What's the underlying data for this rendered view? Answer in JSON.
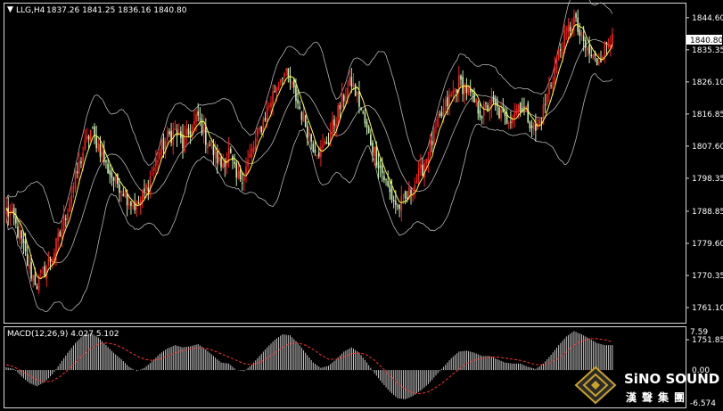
{
  "header": {
    "arrow_glyph": "▼",
    "symbol": "LLG,H4",
    "ohlc": "1837.26 1841.25 1836.16 1840.80"
  },
  "current_price_label": "1840.80",
  "macd": {
    "label": "MACD(12,26,9) 4.027 5.102",
    "axis_top": "7.59",
    "axis_mid": "0.00",
    "axis_bottom": "-6.574"
  },
  "brand": {
    "name_en": "SiNO SOUND",
    "name_zh": "漢聲集團",
    "icon": "diamond-logo-icon"
  },
  "colors": {
    "background": "#000000",
    "bull": "#ff2020",
    "bear": "#c8f0b4",
    "ma": "#ffff40",
    "band": "#b4b4b4",
    "signal": "#ff3030",
    "histogram": "#c8c8c8",
    "frame": "#d8d8d8"
  },
  "chart_data": {
    "type": "candlestick",
    "symbol": "LLG",
    "timeframe": "H4",
    "ylim": [
      1757.0,
      1848.4
    ],
    "y_ticks": [
      1844.6,
      1835.35,
      1826.1,
      1816.85,
      1807.6,
      1798.35,
      1788.85,
      1779.6,
      1770.35,
      1761.1,
      1751.85
    ],
    "y_tick_labels": [
      "1844.60",
      "1835.35",
      "1826.10",
      "1816.85",
      "1807.60",
      "1798.35",
      "1788.85",
      "1779.60",
      "1770.35",
      "1761.10",
      "1751.85"
    ],
    "close_path": [
      1789,
      1786,
      1780,
      1772,
      1768,
      1772,
      1776,
      1782,
      1790,
      1798,
      1806,
      1812,
      1808,
      1802,
      1798,
      1796,
      1792,
      1790,
      1794,
      1800,
      1806,
      1810,
      1812,
      1808,
      1812,
      1816,
      1810,
      1806,
      1802,
      1806,
      1798,
      1800,
      1806,
      1812,
      1818,
      1824,
      1829,
      1826,
      1820,
      1814,
      1808,
      1806,
      1810,
      1816,
      1822,
      1826,
      1820,
      1812,
      1806,
      1800,
      1794,
      1790,
      1792,
      1796,
      1800,
      1806,
      1812,
      1818,
      1822,
      1826,
      1824,
      1820,
      1817,
      1820,
      1818,
      1815,
      1817,
      1820,
      1816,
      1812,
      1818,
      1826,
      1834,
      1840,
      1844,
      1838,
      1834,
      1832,
      1836,
      1840
    ],
    "macd_ylim": [
      -6.574,
      7.59
    ],
    "macd_histogram": [
      0.5,
      0.2,
      -1.2,
      -2.4,
      -3.0,
      -2.2,
      -0.8,
      1.2,
      3.2,
      5.0,
      6.4,
      6.8,
      6.0,
      4.6,
      3.2,
      2.0,
      0.6,
      -0.2,
      0.4,
      1.6,
      3.0,
      4.0,
      4.6,
      4.2,
      4.4,
      4.8,
      3.8,
      2.6,
      1.4,
      1.2,
      0.0,
      -0.2,
      1.0,
      2.6,
      4.2,
      5.6,
      6.6,
      6.4,
      5.0,
      3.2,
      1.4,
      0.4,
      0.8,
      2.0,
      3.4,
      4.2,
      3.2,
      1.4,
      -0.6,
      -2.4,
      -4.0,
      -5.2,
      -5.4,
      -4.8,
      -3.8,
      -2.6,
      -1.0,
      0.6,
      2.2,
      3.4,
      3.6,
      3.2,
      2.6,
      2.6,
      2.0,
      1.4,
      1.2,
      1.2,
      0.6,
      0.2,
      1.2,
      2.8,
      4.6,
      6.2,
      7.2,
      6.6,
      5.8,
      5.0,
      4.6,
      4.6
    ],
    "macd_signal": [
      1.0,
      0.6,
      -0.2,
      -1.0,
      -1.8,
      -2.2,
      -2.0,
      -1.2,
      0.0,
      1.4,
      2.8,
      4.0,
      4.8,
      5.0,
      4.8,
      4.2,
      3.4,
      2.6,
      2.0,
      1.8,
      2.0,
      2.6,
      3.2,
      3.6,
      3.9,
      4.1,
      4.0,
      3.6,
      3.0,
      2.4,
      1.8,
      1.2,
      1.0,
      1.4,
      2.2,
      3.2,
      4.2,
      4.9,
      5.0,
      4.6,
      3.8,
      2.8,
      2.0,
      2.0,
      2.4,
      3.0,
      3.2,
      2.8,
      1.8,
      0.4,
      -1.0,
      -2.4,
      -3.6,
      -4.2,
      -4.4,
      -4.0,
      -3.2,
      -2.2,
      -1.0,
      0.2,
      1.2,
      1.8,
      2.2,
      2.4,
      2.4,
      2.2,
      2.0,
      1.8,
      1.4,
      1.0,
      1.0,
      1.4,
      2.2,
      3.4,
      4.6,
      5.4,
      5.8,
      5.8,
      5.6,
      5.2
    ]
  }
}
